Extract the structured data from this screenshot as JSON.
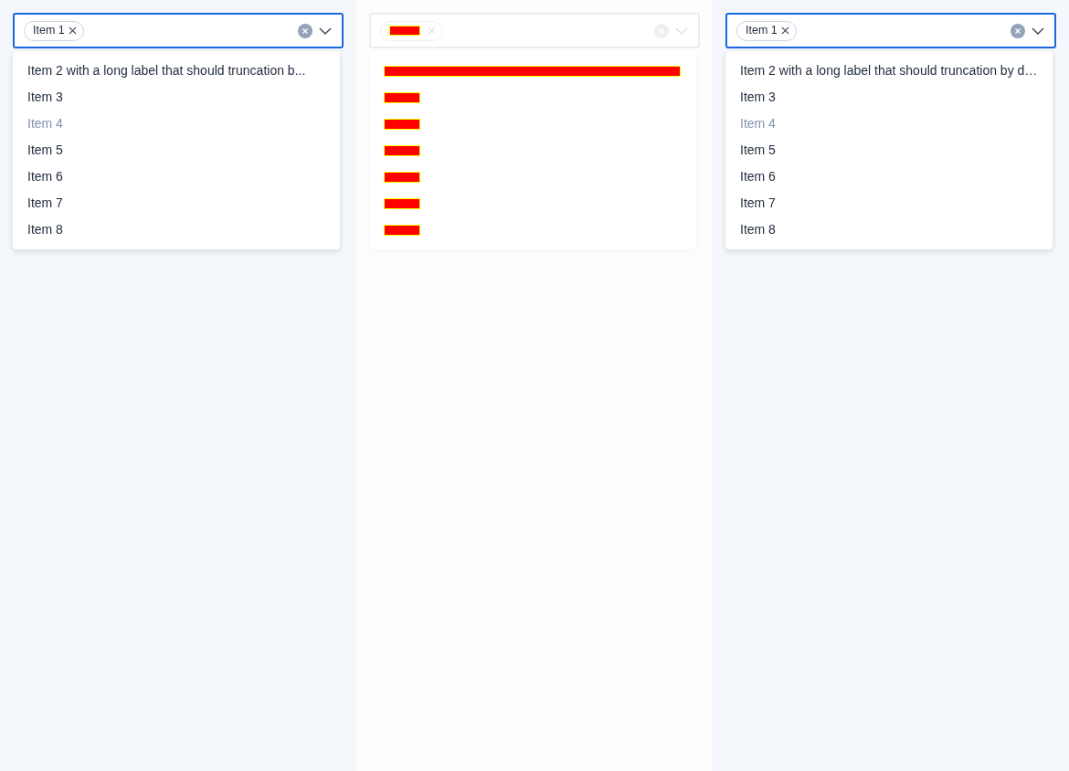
{
  "panels": [
    {
      "kind": "select",
      "focused": true,
      "tag": {
        "label": "Item 1"
      },
      "options": [
        {
          "label": "Item 2 with a long label that should truncation b...",
          "disabled": false
        },
        {
          "label": "Item 3",
          "disabled": false
        },
        {
          "label": "Item 4",
          "disabled": true
        },
        {
          "label": "Item 5",
          "disabled": false
        },
        {
          "label": "Item 6",
          "disabled": false
        },
        {
          "label": "Item 7",
          "disabled": false
        },
        {
          "label": "Item 8",
          "disabled": false
        }
      ]
    },
    {
      "kind": "diff",
      "tag": {
        "changed": true
      },
      "options": [
        {
          "changed": true
        },
        {
          "changed": true
        },
        {
          "changed": true
        },
        {
          "changed": true
        },
        {
          "changed": true
        },
        {
          "changed": true
        },
        {
          "changed": true
        }
      ]
    },
    {
      "kind": "select",
      "focused": true,
      "tag": {
        "label": "Item 1"
      },
      "options": [
        {
          "label": "Item 2 with a long label that should truncation by d…",
          "disabled": false
        },
        {
          "label": "Item 3",
          "disabled": false
        },
        {
          "label": "Item 4",
          "disabled": true
        },
        {
          "label": "Item 5",
          "disabled": false
        },
        {
          "label": "Item 6",
          "disabled": false
        },
        {
          "label": "Item 7",
          "disabled": false
        },
        {
          "label": "Item 8",
          "disabled": false
        }
      ]
    }
  ]
}
